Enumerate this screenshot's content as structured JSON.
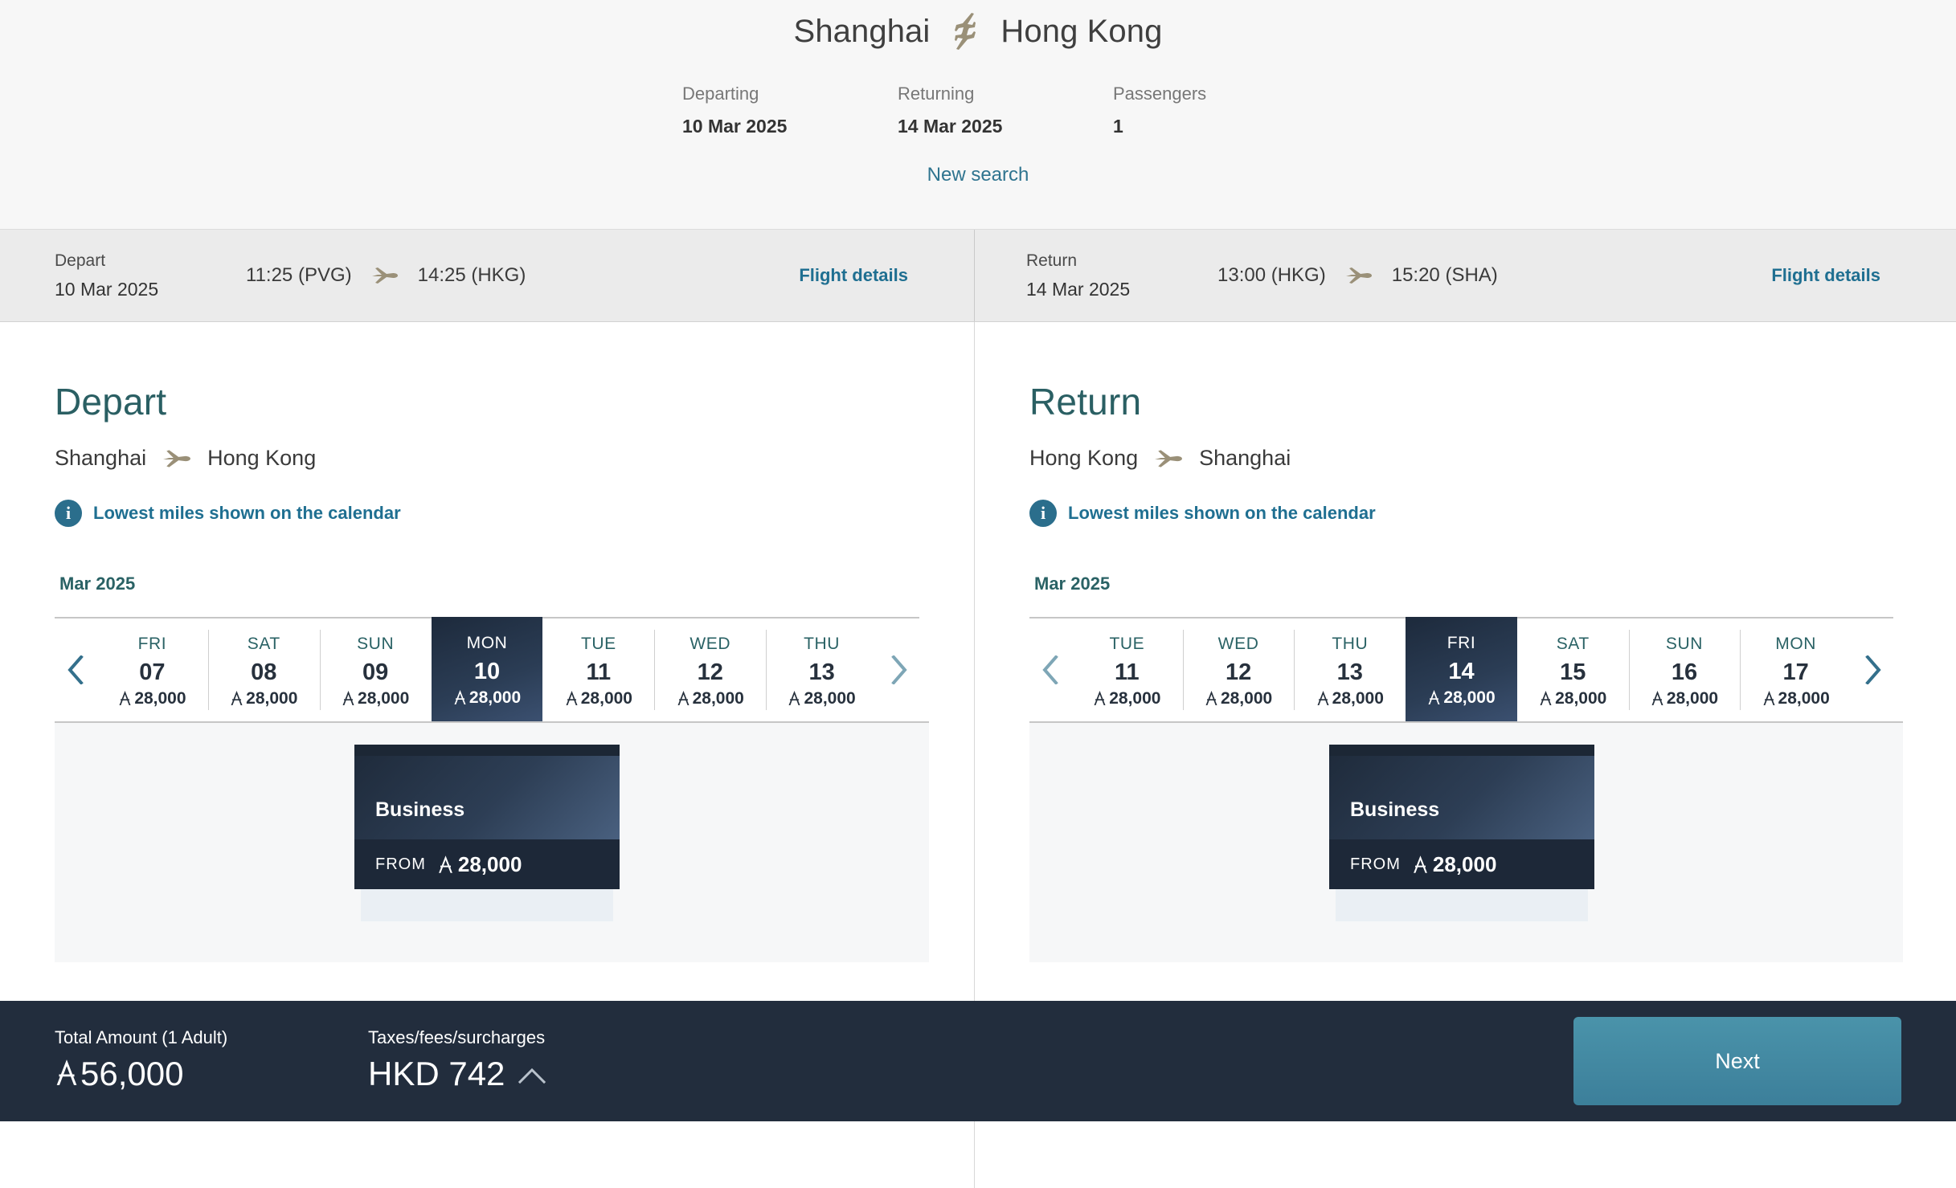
{
  "header": {
    "origin": "Shanghai",
    "destination": "Hong Kong",
    "roundtrip_icon": "roundtrip-plane-icon",
    "departing_label": "Departing",
    "departing_value": "10 Mar 2025",
    "returning_label": "Returning",
    "returning_value": "14 Mar 2025",
    "passengers_label": "Passengers",
    "passengers_value": "1",
    "new_search_label": "New search"
  },
  "summary": {
    "depart": {
      "direction_label": "Depart",
      "date": "10 Mar 2025",
      "time_from": "11:25 (PVG)",
      "time_to": "14:25 (HKG)",
      "plane_icon": "plane-icon",
      "details_label": "Flight details"
    },
    "return": {
      "direction_label": "Return",
      "date": "14 Mar 2025",
      "time_from": "13:00 (HKG)",
      "time_to": "15:20 (SHA)",
      "plane_icon": "plane-icon",
      "details_label": "Flight details"
    }
  },
  "miles_symbol_name": "asia-miles-icon",
  "depart_pane": {
    "title": "Depart",
    "route_from": "Shanghai",
    "route_to": "Hong Kong",
    "plane_icon": "plane-icon",
    "info_icon": "info-icon",
    "lowest_note": "Lowest miles shown on the calendar",
    "calendar": {
      "month": "Mar 2025",
      "prev_icon": "chevron-left-icon",
      "next_icon": "chevron-right-icon",
      "days": [
        {
          "dow": "FRI",
          "num": "07",
          "miles": "28,000",
          "selected": false
        },
        {
          "dow": "SAT",
          "num": "08",
          "miles": "28,000",
          "selected": false
        },
        {
          "dow": "SUN",
          "num": "09",
          "miles": "28,000",
          "selected": false
        },
        {
          "dow": "MON",
          "num": "10",
          "miles": "28,000",
          "selected": true
        },
        {
          "dow": "TUE",
          "num": "11",
          "miles": "28,000",
          "selected": false
        },
        {
          "dow": "WED",
          "num": "12",
          "miles": "28,000",
          "selected": false
        },
        {
          "dow": "THU",
          "num": "13",
          "miles": "28,000",
          "selected": false
        }
      ]
    },
    "cabin_card": {
      "cabin": "Business",
      "from_label": "FROM",
      "from_miles": "28,000"
    }
  },
  "return_pane": {
    "title": "Return",
    "route_from": "Hong Kong",
    "route_to": "Shanghai",
    "plane_icon": "plane-icon",
    "info_icon": "info-icon",
    "lowest_note": "Lowest miles shown on the calendar",
    "calendar": {
      "month": "Mar 2025",
      "prev_icon": "chevron-left-icon",
      "next_icon": "chevron-right-icon",
      "days": [
        {
          "dow": "TUE",
          "num": "11",
          "miles": "28,000",
          "selected": false
        },
        {
          "dow": "WED",
          "num": "12",
          "miles": "28,000",
          "selected": false
        },
        {
          "dow": "THU",
          "num": "13",
          "miles": "28,000",
          "selected": false
        },
        {
          "dow": "FRI",
          "num": "14",
          "miles": "28,000",
          "selected": true
        },
        {
          "dow": "SAT",
          "num": "15",
          "miles": "28,000",
          "selected": false
        },
        {
          "dow": "SUN",
          "num": "16",
          "miles": "28,000",
          "selected": false
        },
        {
          "dow": "MON",
          "num": "17",
          "miles": "28,000",
          "selected": false
        }
      ]
    },
    "cabin_card": {
      "cabin": "Business",
      "from_label": "FROM",
      "from_miles": "28,000"
    }
  },
  "footer": {
    "total_label": "Total Amount (1 Adult)",
    "total_value": "56,000",
    "taxes_label": "Taxes/fees/surcharges",
    "taxes_value": "HKD 742",
    "taxes_toggle_icon": "chevron-up-icon",
    "next_label": "Next"
  },
  "colors": {
    "accent_teal": "#2a5f63",
    "link_blue": "#1f6f91",
    "selected_navy": "#1d2a3c",
    "footer_navy": "#222d3d",
    "button_blue": "#3c7f9a"
  }
}
